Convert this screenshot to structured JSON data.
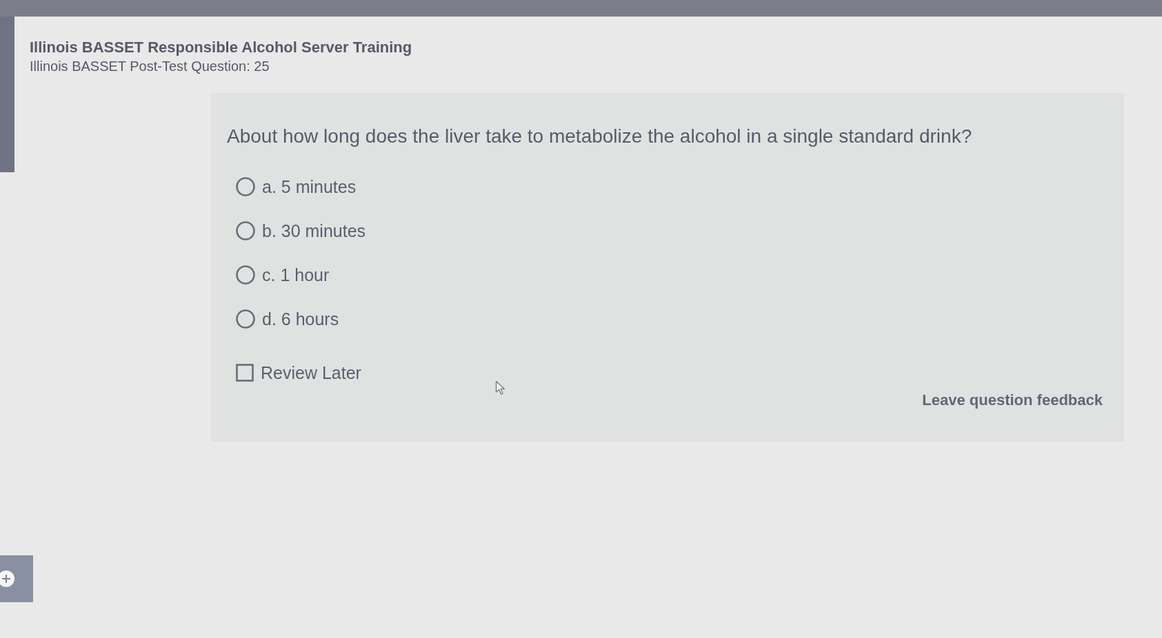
{
  "header": {
    "title": "Illinois BASSET Responsible Alcohol Server Training",
    "subtitle": "Illinois BASSET Post-Test Question: 25"
  },
  "question": {
    "text": "About how long does the liver take to metabolize the alcohol in a single standard drink?",
    "options": [
      {
        "label": "a. 5 minutes",
        "selected": false
      },
      {
        "label": "b. 30 minutes",
        "selected": false
      },
      {
        "label": "c. 1 hour",
        "selected": false
      },
      {
        "label": "d. 6 hours",
        "selected": false
      }
    ],
    "review_later": {
      "label": "Review Later",
      "checked": false
    },
    "feedback_link": "Leave question feedback"
  }
}
